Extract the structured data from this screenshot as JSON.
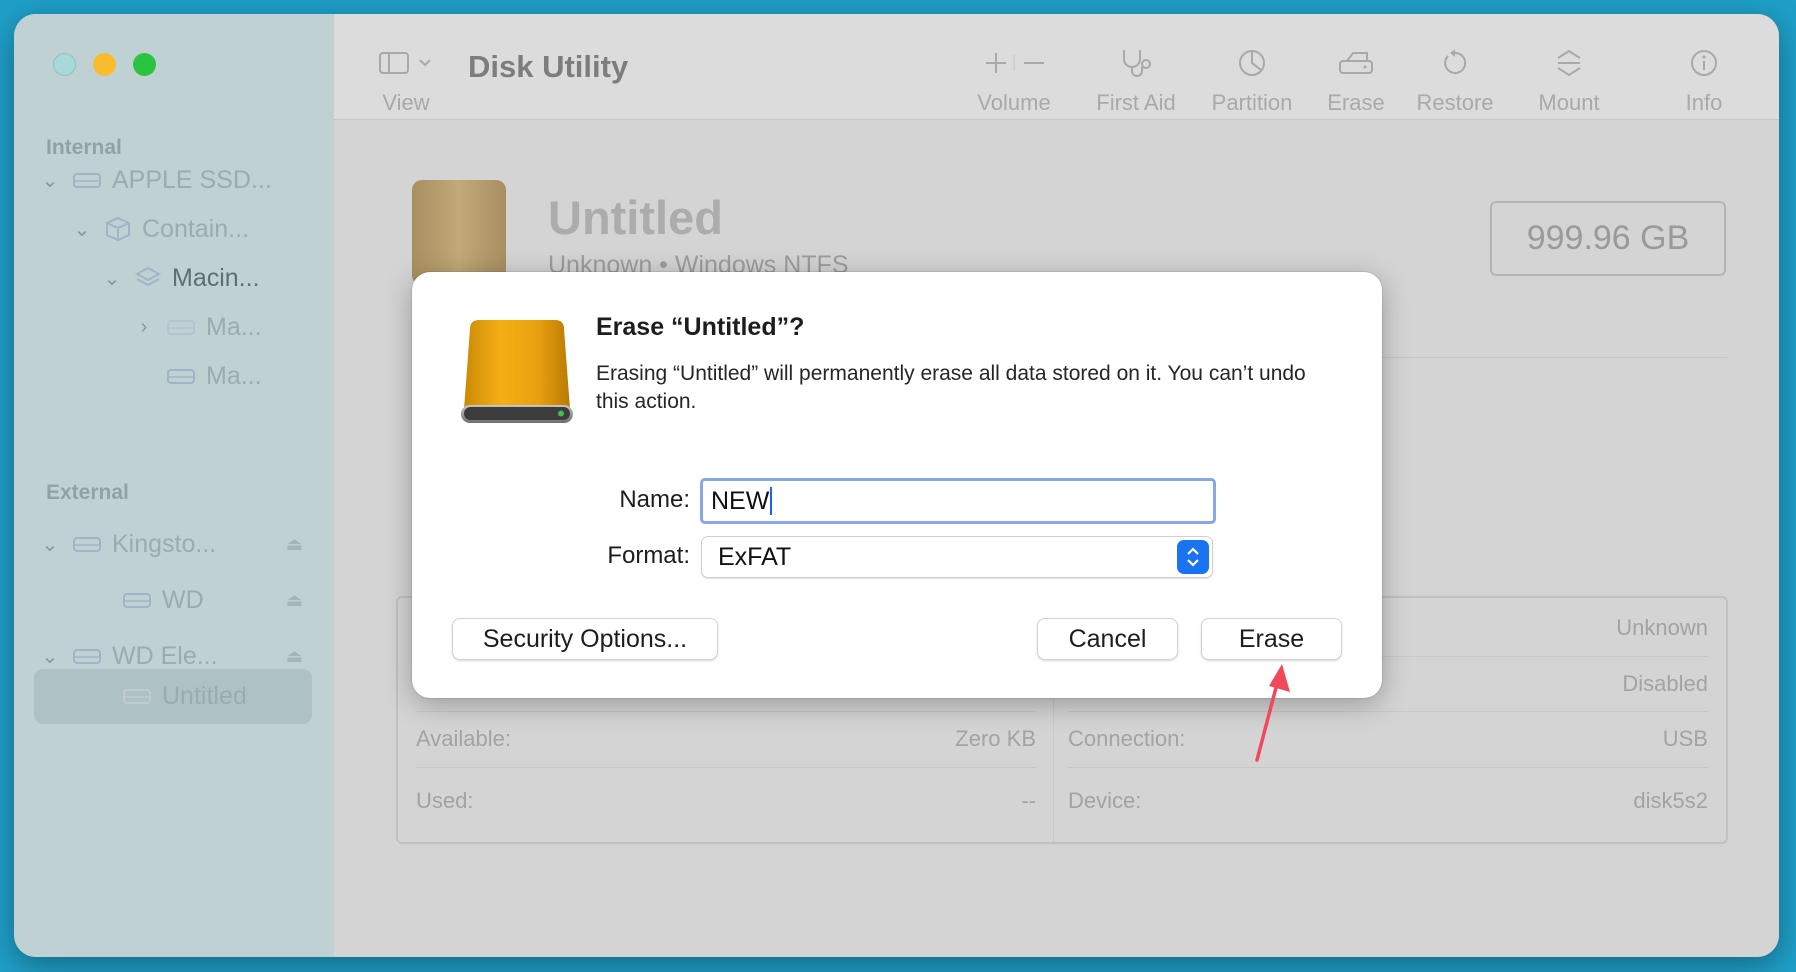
{
  "window": {
    "title": "Disk Utility"
  },
  "toolbar": {
    "view_label": "View",
    "volume_label": "Volume",
    "first_aid_label": "First Aid",
    "partition_label": "Partition",
    "erase_label": "Erase",
    "restore_label": "Restore",
    "mount_label": "Mount",
    "info_label": "Info"
  },
  "sidebar": {
    "internal_header": "Internal",
    "external_header": "External",
    "internal_items": [
      {
        "label": "APPLE SSD...",
        "icon": "drive-icon"
      },
      {
        "label": "Contain...",
        "icon": "container-icon"
      },
      {
        "label": "Macin...",
        "icon": "layers-icon"
      },
      {
        "label": "Ma...",
        "icon": "drive-icon"
      },
      {
        "label": "Ma...",
        "icon": "drive-icon"
      }
    ],
    "external_items": [
      {
        "label": "Kingsto...",
        "icon": "drive-icon"
      },
      {
        "label": "WD",
        "icon": "drive-icon"
      },
      {
        "label": "WD Ele...",
        "icon": "drive-icon"
      },
      {
        "label": "Untitled",
        "icon": "drive-icon"
      }
    ]
  },
  "disk": {
    "name": "Untitled",
    "subtitle": "Unknown • Windows NTFS",
    "capacity": "999.96 GB"
  },
  "info": {
    "right_values": [
      "Unknown",
      "Disabled"
    ],
    "available_label": "Available:",
    "available_value": "Zero KB",
    "used_label": "Used:",
    "used_value": "--",
    "connection_label": "Connection:",
    "connection_value": "USB",
    "device_label": "Device:",
    "device_value": "disk5s2"
  },
  "dialog": {
    "title": "Erase “Untitled”?",
    "message": "Erasing “Untitled” will permanently erase all data stored on it. You can’t undo this action.",
    "name_label": "Name:",
    "name_value": "NEW",
    "format_label": "Format:",
    "format_value": "ExFAT",
    "security_button": "Security Options...",
    "cancel_button": "Cancel",
    "erase_button": "Erase"
  },
  "colors": {
    "accent": "#1a73f0",
    "annotation_arrow": "#ef4a5b",
    "sidebar_bg": "#c0d1d3"
  }
}
